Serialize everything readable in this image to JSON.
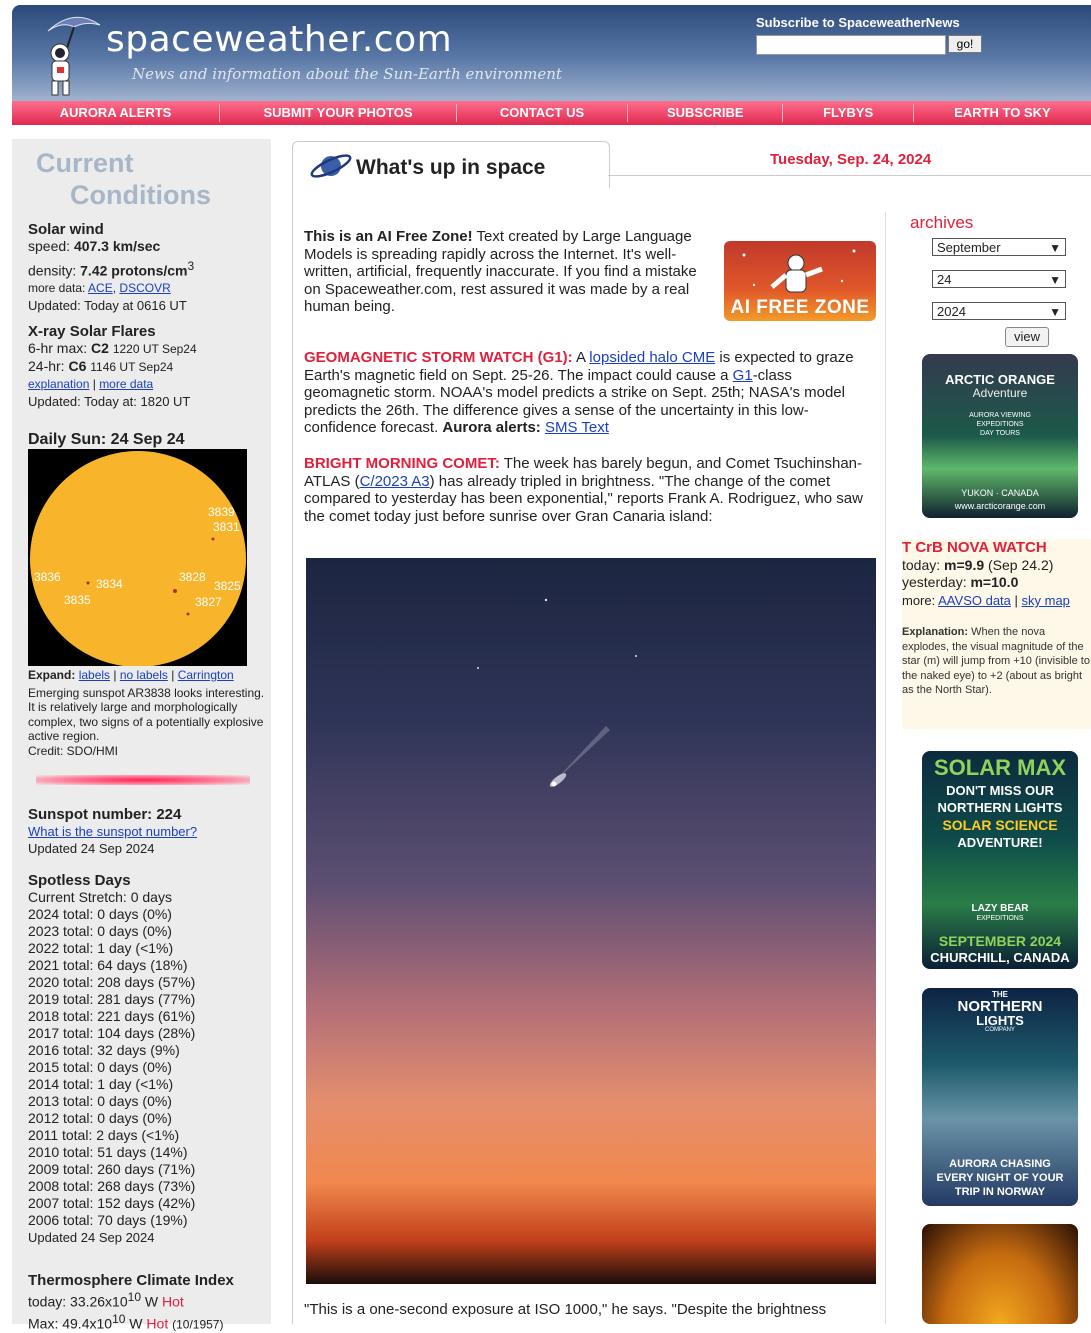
{
  "header": {
    "site_title": "spaceweather.com",
    "tagline": "News and information about the Sun-Earth environment",
    "subscribe_label": "Subscribe to SpaceweatherNews",
    "go_label": "go!"
  },
  "nav": [
    "AURORA ALERTS",
    "SUBMIT YOUR PHOTOS",
    "CONTACT US",
    "SUBSCRIBE",
    "FLYBYS",
    "EARTH TO SKY"
  ],
  "left": {
    "title_line1": "Current",
    "title_line2": "Conditions",
    "solar_wind": {
      "heading": "Solar wind",
      "speed_label": "speed:",
      "speed_value": "407.3 km/sec",
      "density_label": "density:",
      "density_value": "7.42 protons/cm",
      "density_exp": "3",
      "more_data_label": "more data:",
      "link_ace": "ACE",
      "link_dscovr": "DSCOVR",
      "updated": "Updated: Today at 0616 UT"
    },
    "xray": {
      "heading": "X-ray Solar Flares",
      "six_hr_label": "6-hr max:",
      "six_hr_class": "C2",
      "six_hr_time": "1220 UT Sep24",
      "day_label": "24-hr:",
      "day_class": "C6",
      "day_time": "1146 UT Sep24",
      "link_explanation": "explanation",
      "link_more_data": "more data",
      "updated": "Updated: Today at: 1820 UT"
    },
    "daily_sun": {
      "heading": "Daily Sun: 24 Sep 24",
      "spots": [
        "3839",
        "3831",
        "3836",
        "3834",
        "3828",
        "3825",
        "3835",
        "3827"
      ],
      "expand_label": "Expand:",
      "link_labels": "labels",
      "link_no_labels": "no labels",
      "link_carrington": "Carrington",
      "caption": "Emerging sunspot AR3838 looks interesting. It is relatively large and morphologically complex, two signs of a potentially explosive active region.",
      "credit": "Credit: SDO/HMI"
    },
    "sunspot": {
      "heading": "Sunspot number: 224",
      "link": "What is the sunspot number?",
      "updated": "Updated 24 Sep 2024"
    },
    "spotless": {
      "heading": "Spotless Days",
      "stretch": "Current Stretch: 0 days",
      "years": [
        "2024 total: 0 days (0%)",
        "2023 total: 0 days (0%)",
        "2022 total: 1 day (<1%)",
        "2021 total: 64 days (18%)",
        "2020 total: 208 days (57%)",
        "2019 total: 281 days (77%)",
        "2018 total: 221 days (61%)",
        "2017 total: 104 days (28%)",
        "2016 total: 32 days (9%)",
        "2015 total: 0 days (0%)",
        "2014 total: 1 day (<1%)",
        "2013 total: 0 days (0%)",
        "2012 total: 0 days (0%)",
        "2011 total: 2 days (<1%)",
        "2010 total: 51 days (14%)",
        "2009 total: 260 days (71%)",
        "2008 total: 268 days (73%)",
        "2007 total: 152 days (42%)",
        "2006 total: 70 days (19%)"
      ],
      "updated": "Updated 24 Sep 2024"
    },
    "thermo": {
      "heading": "Thermosphere Climate Index",
      "today_prefix": "today: 33.26x10",
      "today_exp": "10",
      "today_unit": " W ",
      "today_status": "Hot",
      "max_prefix": "Max: 49.4x10",
      "max_exp": "10",
      "max_unit": " W ",
      "max_status": "Hot",
      "max_date": "(10/1957)"
    }
  },
  "main": {
    "tab_title": "What's up in space",
    "date": "Tuesday, Sep. 24, 2024",
    "ai_free": {
      "bold": "This is an AI Free Zone!",
      "text": " Text created by Large Language Models is spreading rapidly across the Internet. It's well-written, artificial, frequently inaccurate. If you find a mistake on Spaceweather.com, rest assured it was made by a real human being.",
      "badge": "AI FREE ZONE"
    },
    "storm": {
      "title": "GEOMAGNETIC STORM WATCH (G1):",
      "t1": " A ",
      "link1": "lopsided halo CME",
      "t2": " is expected to graze Earth's magnetic field on Sept. 25-26. The impact could cause a ",
      "link2": "G1",
      "t3": "-class geomagnetic storm. NOAA's model predicts a strike on Sept. 25th; NASA's model predicts the 26th. The difference gives a sense of the uncertainty in this low-confidence forecast. ",
      "alerts_bold": "Aurora alerts:",
      "link3": "SMS Text"
    },
    "comet": {
      "title": "BRIGHT MORNING COMET:",
      "t1": " The week has barely begun, and Comet Tsuchinshan-ATLAS (",
      "link1": "C/2023 A3",
      "t2": ") has already tripled in brightness. \"The change of the comet compared to yesterday has been exponential,\" reports Frank A. Rodriguez, who saw the comet today just before sunrise over Gran Canaria island:"
    },
    "caption": "\"This is a one-second exposure at ISO 1000,\" he says. \"Despite the brightness"
  },
  "right": {
    "archives_label": "archives",
    "month": "September",
    "day": "24",
    "year": "2024",
    "view_label": "view",
    "ad1": {
      "line1": "ARCTIC ORANGE",
      "line2": "Adventure",
      "line3": "AURORA VIEWING",
      "line4": "EXPEDITIONS",
      "line5": "DAY TOURS",
      "line6": "YUKON · CANADA",
      "line7": "www.arcticorange.com"
    },
    "nova": {
      "title": "T CrB NOVA WATCH",
      "today_prefix": "today: ",
      "today_value": "m=9.9",
      "today_suffix": " (Sep 24.2)",
      "yesterday_prefix": "yesterday: ",
      "yesterday_value": "m=10.0",
      "more_label": "more:",
      "link_aavso": "AAVSO data",
      "link_sky": "sky map",
      "explanation_bold": "Explanation:",
      "explanation": " When the nova explodes, the visual magnitude of the star (m) will jump from +10 (invisible to the naked eye) to +2 (about as bright as the North Star)."
    },
    "ad2": {
      "line1": "SOLAR MAX",
      "line2": "DON'T MISS OUR",
      "line3": "NORTHERN LIGHTS",
      "line4": "SOLAR SCIENCE",
      "line5": "ADVENTURE!",
      "line6": "LAZY BEAR",
      "line7": "EXPEDITIONS",
      "line8": "SEPTEMBER 2024",
      "line9": "CHURCHILL, CANADA"
    },
    "ad3": {
      "line1": "THE",
      "line2": "NORTHERN",
      "line3": "LIGHTS",
      "line4": "COMPANY",
      "line5": "AURORA CHASING",
      "line6": "EVERY NIGHT OF YOUR",
      "line7": "TRIP IN NORWAY"
    }
  }
}
